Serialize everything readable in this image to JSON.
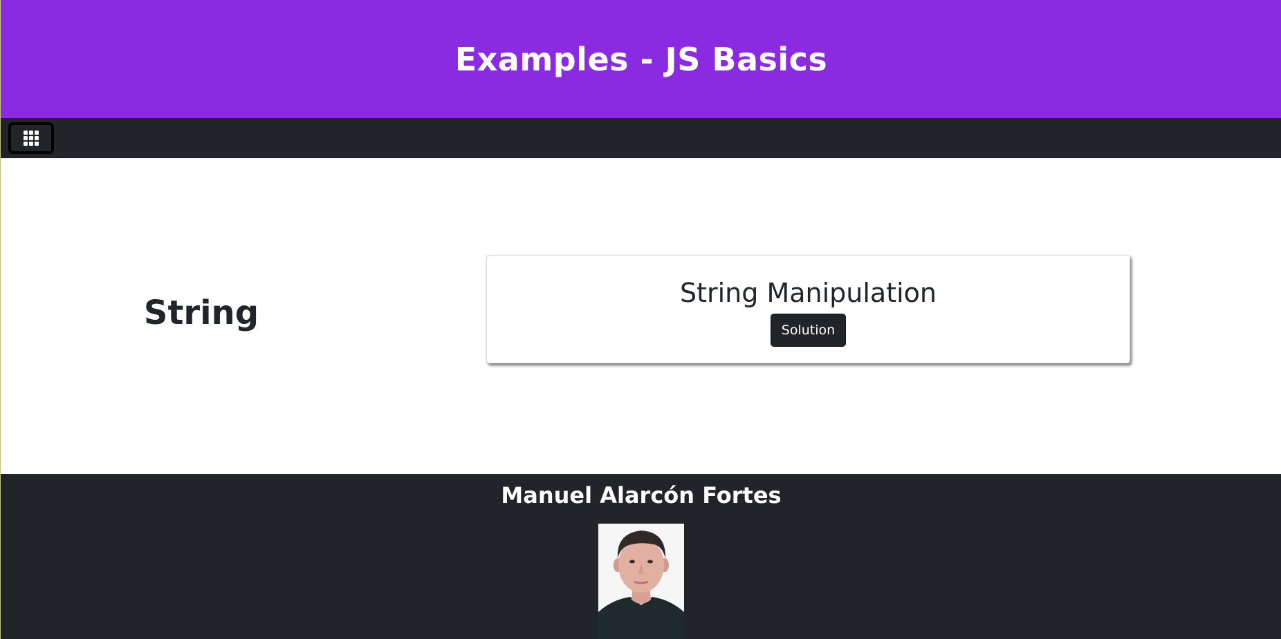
{
  "header": {
    "title": "Examples - JS Basics"
  },
  "navbar": {
    "menu_icon": "grid-icon"
  },
  "main": {
    "section_title": "String",
    "cards": [
      {
        "title": "String Manipulation",
        "button_label": "Solution"
      }
    ]
  },
  "footer": {
    "author": "Manuel Alarcón Fortes",
    "avatar": "author-photo"
  },
  "colors": {
    "header_bg": "#8a2be2",
    "dark_bg": "#212529",
    "text": "#212529",
    "light_text": "#ffffff"
  }
}
